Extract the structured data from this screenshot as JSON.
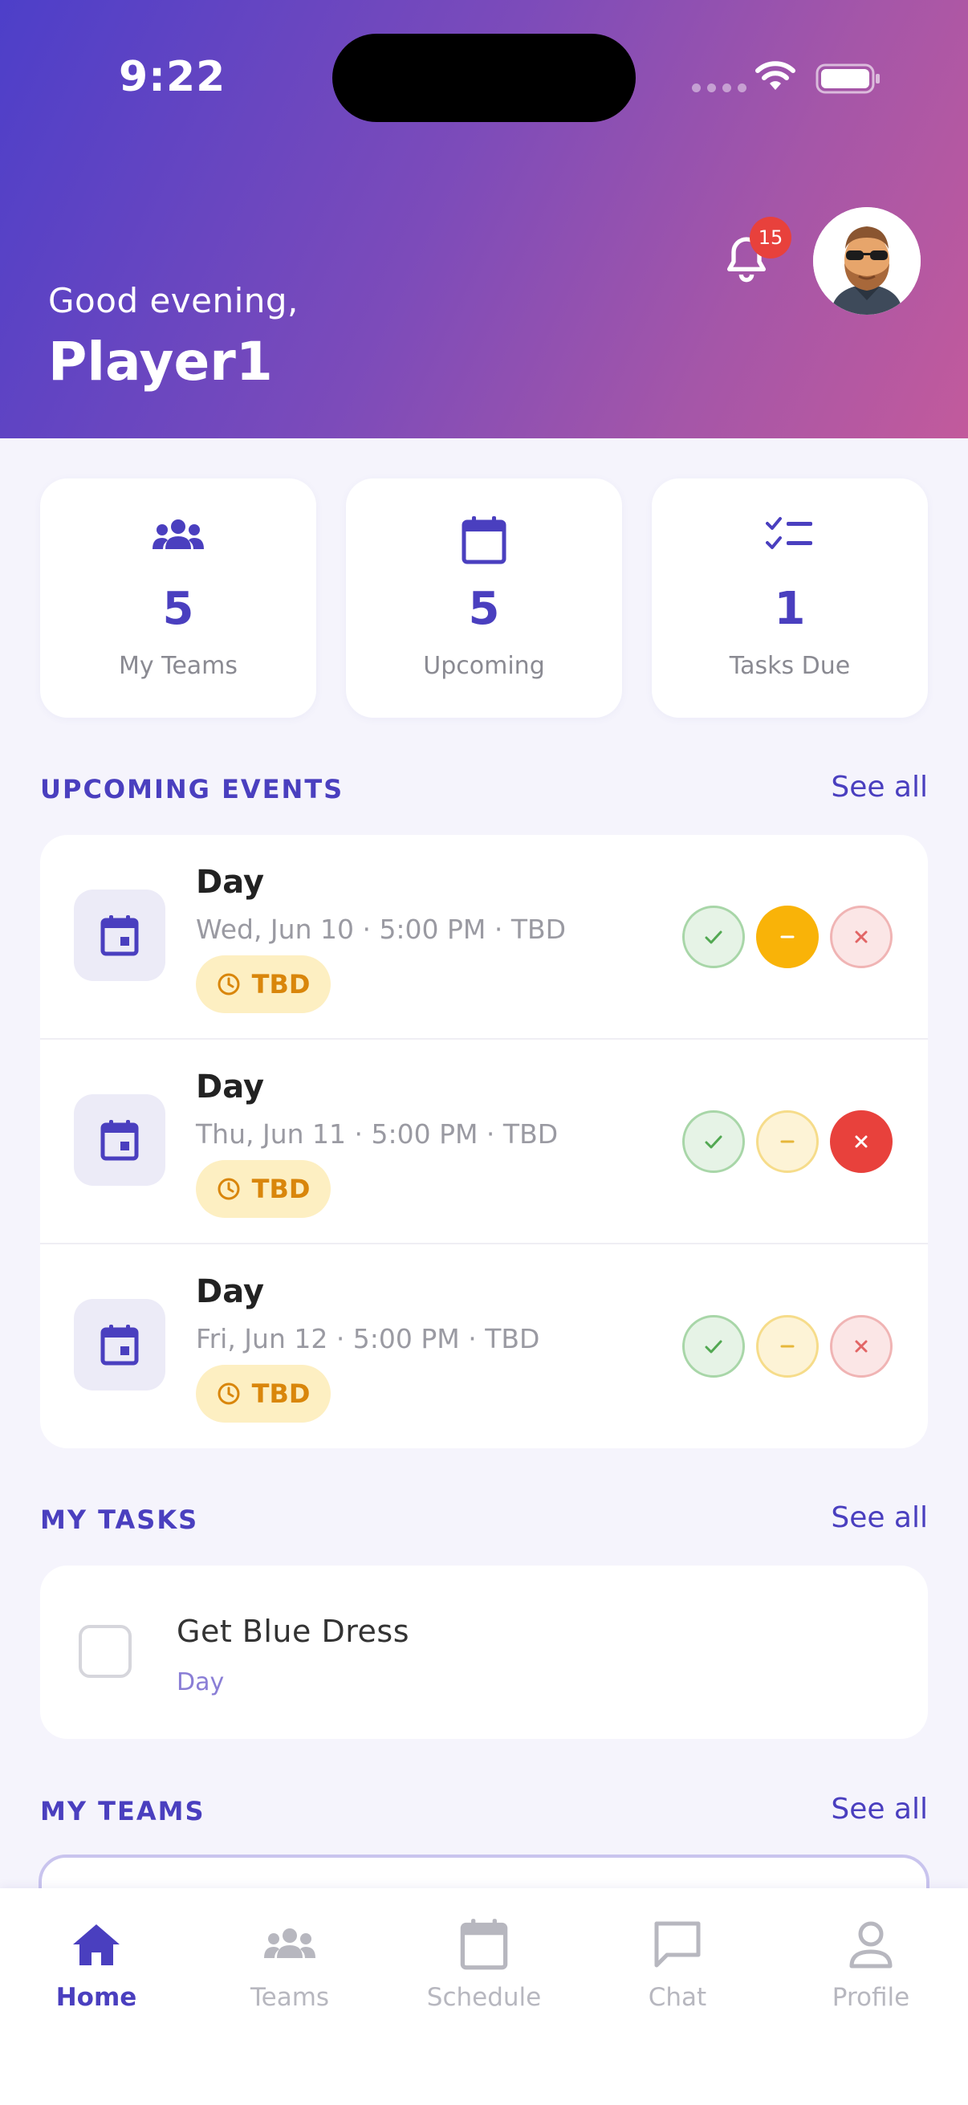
{
  "status_bar": {
    "time": "9:22"
  },
  "header": {
    "greeting": "Good evening,",
    "name": "Player1",
    "notification_count": "15"
  },
  "stats": [
    {
      "value": "5",
      "label": "My Teams",
      "icon": "group-icon"
    },
    {
      "value": "5",
      "label": "Upcoming",
      "icon": "calendar-icon"
    },
    {
      "value": "1",
      "label": "Tasks Due",
      "icon": "checklist-icon"
    }
  ],
  "upcoming_events": {
    "title": "UPCOMING EVENTS",
    "see_all": "See all",
    "items": [
      {
        "title": "Day",
        "subtitle": "Wed, Jun 10 · 5:00 PM · TBD",
        "tag": "TBD",
        "rsvp": "maybe"
      },
      {
        "title": "Day",
        "subtitle": "Thu, Jun 11 · 5:00 PM · TBD",
        "tag": "TBD",
        "rsvp": "no"
      },
      {
        "title": "Day",
        "subtitle": "Fri, Jun 12 · 5:00 PM · TBD",
        "tag": "TBD",
        "rsvp": "none"
      }
    ]
  },
  "my_tasks": {
    "title": "MY TASKS",
    "see_all": "See all",
    "items": [
      {
        "title": "Get Blue Dress",
        "subtitle": "Day",
        "checked": false
      }
    ]
  },
  "my_teams": {
    "title": "MY TEAMS",
    "see_all": "See all"
  },
  "nav": {
    "items": [
      {
        "label": "Home",
        "icon": "home-icon",
        "active": true
      },
      {
        "label": "Teams",
        "icon": "group-icon",
        "active": false
      },
      {
        "label": "Schedule",
        "icon": "calendar-icon",
        "active": false
      },
      {
        "label": "Chat",
        "icon": "chat-icon",
        "active": false
      },
      {
        "label": "Profile",
        "icon": "person-icon",
        "active": false
      }
    ]
  },
  "colors": {
    "accent": "#4a3fbf",
    "maybe": "#f9b308",
    "no": "#e8413c",
    "tag_bg": "#fdefc2",
    "tag_text": "#d9860b"
  }
}
